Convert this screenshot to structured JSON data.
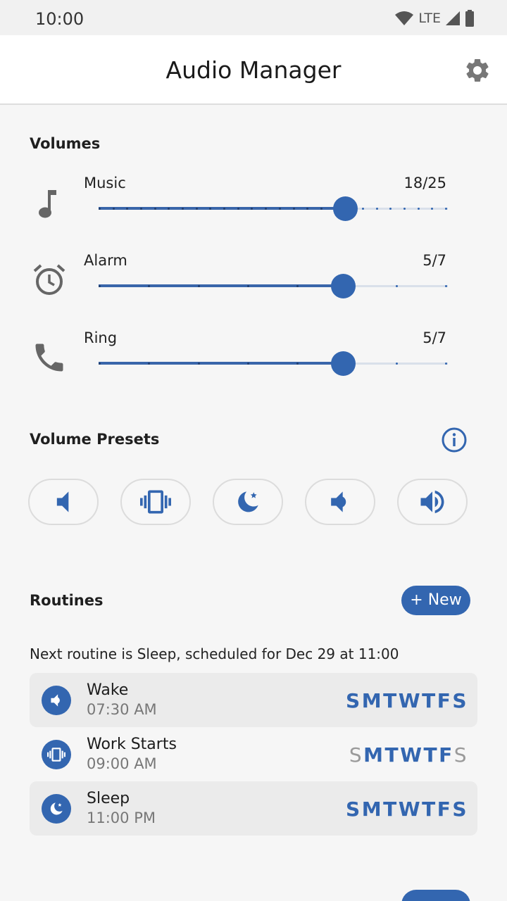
{
  "status_bar": {
    "time": "10:00",
    "network": "LTE"
  },
  "app_bar": {
    "title": "Audio Manager",
    "settings_icon": "gear-icon"
  },
  "volumes": {
    "title": "Volumes",
    "items": [
      {
        "label": "Music",
        "value_text": "18/25",
        "value": 18,
        "max": 25,
        "icon": "music-note-icon"
      },
      {
        "label": "Alarm",
        "value_text": "5/7",
        "value": 5,
        "max": 7,
        "icon": "alarm-clock-icon"
      },
      {
        "label": "Ring",
        "value_text": "5/7",
        "value": 5,
        "max": 7,
        "icon": "phone-icon"
      }
    ]
  },
  "presets": {
    "title": "Volume Presets",
    "info_icon": "info-icon",
    "items": [
      {
        "icon": "mute-speaker-icon"
      },
      {
        "icon": "vibrate-icon"
      },
      {
        "icon": "moon-icon"
      },
      {
        "icon": "speaker-low-icon"
      },
      {
        "icon": "speaker-high-icon"
      }
    ]
  },
  "routines": {
    "title": "Routines",
    "new_label": "+ New",
    "next_text": "Next routine is Sleep, scheduled for Dec 29 at 11:00",
    "items": [
      {
        "name": "Wake",
        "time": "07:30 AM",
        "icon": "speaker-low-icon",
        "active": true,
        "days": [
          {
            "d": "S",
            "on": true
          },
          {
            "d": "M",
            "on": true
          },
          {
            "d": "T",
            "on": true
          },
          {
            "d": "W",
            "on": true
          },
          {
            "d": "T",
            "on": true
          },
          {
            "d": "F",
            "on": true
          },
          {
            "d": "S",
            "on": true
          }
        ]
      },
      {
        "name": "Work Starts",
        "time": "09:00 AM",
        "icon": "vibrate-icon",
        "active": false,
        "days": [
          {
            "d": "S",
            "on": false
          },
          {
            "d": "M",
            "on": true
          },
          {
            "d": "T",
            "on": true
          },
          {
            "d": "W",
            "on": true
          },
          {
            "d": "T",
            "on": true
          },
          {
            "d": "F",
            "on": true
          },
          {
            "d": "S",
            "on": false
          }
        ]
      },
      {
        "name": "Sleep",
        "time": "11:00 PM",
        "icon": "moon-icon",
        "active": true,
        "days": [
          {
            "d": "S",
            "on": true
          },
          {
            "d": "M",
            "on": true
          },
          {
            "d": "T",
            "on": true
          },
          {
            "d": "W",
            "on": true
          },
          {
            "d": "T",
            "on": true
          },
          {
            "d": "F",
            "on": true
          },
          {
            "d": "S",
            "on": true
          }
        ]
      }
    ]
  },
  "colors": {
    "accent": "#3366b0",
    "track": "#d9e0ea",
    "muted": "#9a9a9a"
  }
}
